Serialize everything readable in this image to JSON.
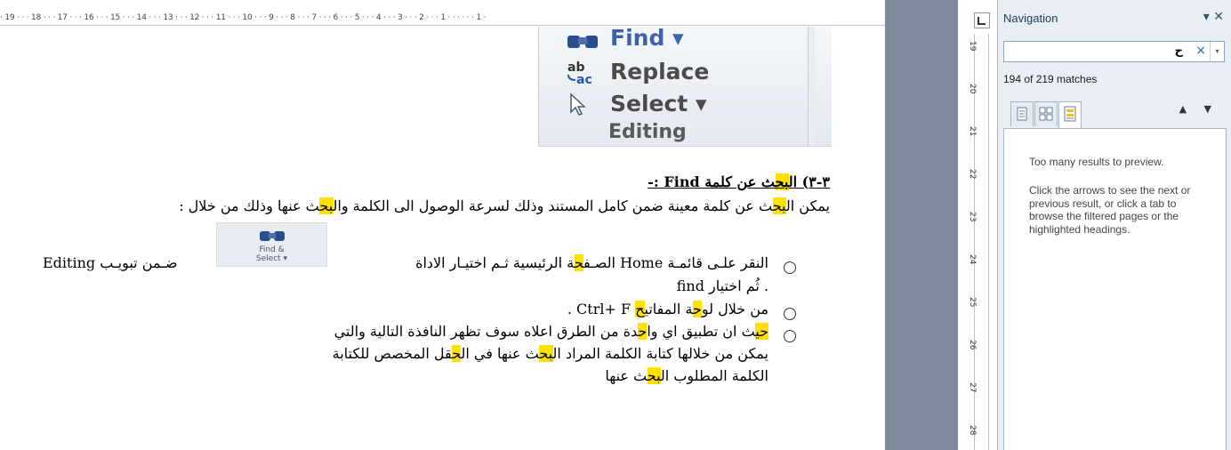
{
  "ruler": {
    "text": "· 19 ·  ·  · 18 ·  ·  · 17 ·  ·  · 16 ·  ·  · 15 ·  ·  · 14 ·  ·  · 13 ·  ·  · 12 ·  ·  · 11 ·  ·  · 10 ·  ·  · 9 ·  ·  · 8 ·  ·  · 7 ·  ·  · 6 ·  ·  · 5 ·  ·  · 4 ·  ·  · 3 ·  ·  · 2 ·  ·  · 1 ·  ·  ·  ·  ·  · 1 ·"
  },
  "vertical_ruler": {
    "numbers": [
      "19",
      "20",
      "21",
      "22",
      "23",
      "24",
      "25",
      "26",
      "27",
      "28"
    ]
  },
  "editing_image": {
    "find_label": "Find ▾",
    "replace_label": "Replace",
    "select_label": "Select ▾",
    "group_label": "Editing"
  },
  "document": {
    "heading_pre": "٣-٣) ال",
    "heading_hl": "بح",
    "heading_post": "ث عن كلمة Find :-",
    "para_pre": "يمكن ال",
    "para_hl1": "بح",
    "para_mid": "ث عن كلمة معينة ضمن كامل المستند وذلك لسرعة الوصول الى الكلمة وال",
    "para_hl2": "بح",
    "para_post": "ث عنها وذلك من خلال :",
    "find_button": "Find &\nSelect ▾",
    "item1_a": "النقر علـى قائمـة  Home الصـف",
    "item1_hl": "ح",
    "item1_b": "ة الرئيسية ثـم اختيـار الاداة",
    "item1_c": "ضـمن تبويـب Editing",
    "item1_line2": "find ثُم اختيار .",
    "item2_a": "من خلال لو",
    "item2_hl1": "ح",
    "item2_b": "ة المفاتي",
    "item2_hl2": "ح",
    "item2_c": " Ctrl+ F .",
    "item3_hl1": "حي",
    "item3_a": "ث ان تطبيق اي وا",
    "item3_hl2": "ح",
    "item3_b": "دة من الطرق اعلاه سوف تظهر النافذة التالية والتي",
    "item3_l2_a": "يمكن من خلالها كتابة الكلمة المراد ال",
    "item3_l2_hl1": "بح",
    "item3_l2_b": "ث عنها في ال",
    "item3_l2_hl2": "ح",
    "item3_l2_c": "قل المخصص للكتابة",
    "item3_l3_a": "الكلمة المطلوب ال",
    "item3_l3_hl": "بح",
    "item3_l3_b": "ث عنها"
  },
  "navigation": {
    "title": "Navigation",
    "controls": "▾ ✕",
    "search_value": "ح",
    "clear": "×",
    "dropdown": "▾",
    "matches": "194 of 219 matches",
    "prev_next": "▲ ▼",
    "message_title": "Too many results to preview.",
    "message_body": "Click the arrows to see the next or previous result, or click a tab to browse the filtered pages or the highlighted headings."
  },
  "colors": {
    "highlight": "#ffe100",
    "workspace": "#7d8a9c",
    "pane": "#e9eef5"
  }
}
